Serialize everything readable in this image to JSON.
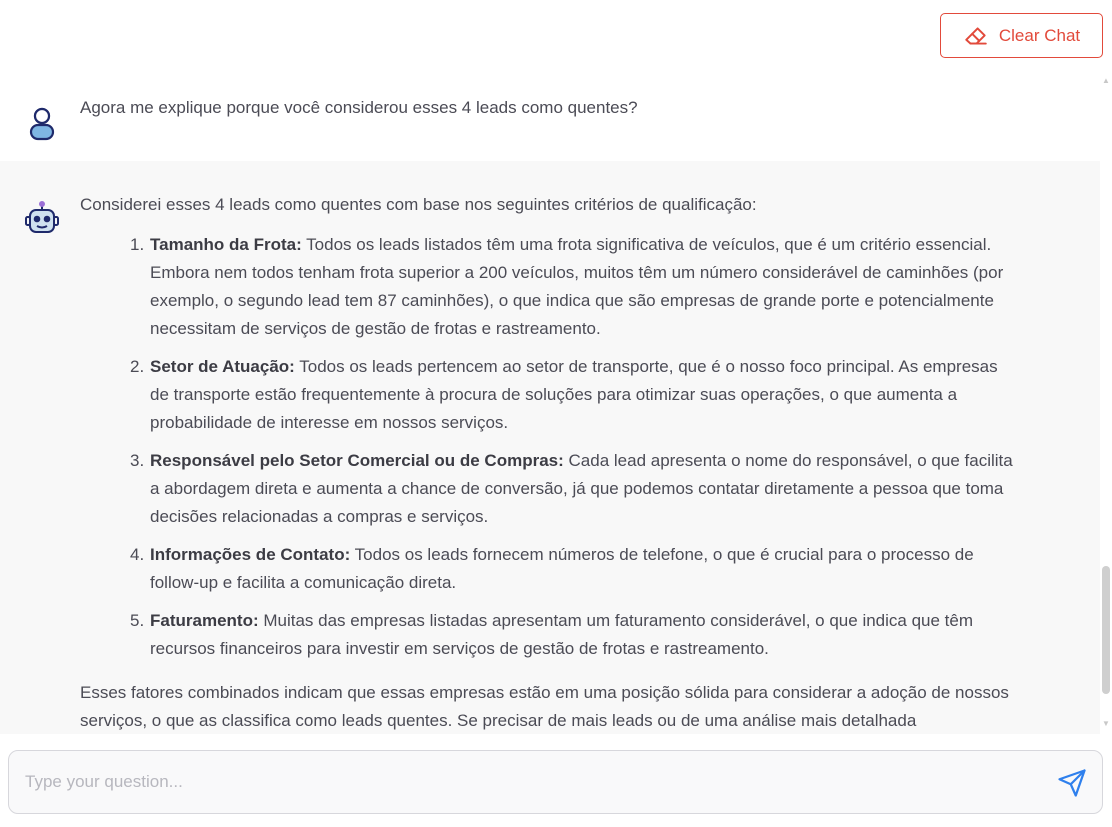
{
  "header": {
    "clear_chat_label": "Clear Chat",
    "clear_chat_icon": "eraser-icon",
    "accent_color": "#e24a3b"
  },
  "messages": {
    "user": {
      "avatar_icon": "user-icon",
      "text": "Agora me explique porque você considerou esses 4 leads como quentes?"
    },
    "bot": {
      "avatar_icon": "robot-icon",
      "intro": "Considerei esses 4 leads como quentes com base nos seguintes critérios de qualificação:",
      "items": [
        {
          "number": "1.",
          "title": "Tamanho da Frota:",
          "text": "Todos os leads listados têm uma frota significativa de veículos, que é um critério essencial. Embora nem todos tenham frota superior a 200 veículos, muitos têm um número considerável de caminhões (por exemplo, o segundo lead tem 87 caminhões), o que indica que são empresas de grande porte e potencialmente necessitam de serviços de gestão de frotas e rastreamento."
        },
        {
          "number": "2.",
          "title": "Setor de Atuação:",
          "text": "Todos os leads pertencem ao setor de transporte, que é o nosso foco principal. As empresas de transporte estão frequentemente à procura de soluções para otimizar suas operações, o que aumenta a probabilidade de interesse em nossos serviços."
        },
        {
          "number": "3.",
          "title": "Responsável pelo Setor Comercial ou de Compras:",
          "text": "Cada lead apresenta o nome do responsável, o que facilita a abordagem direta e aumenta a chance de conversão, já que podemos contatar diretamente a pessoa que toma decisões relacionadas a compras e serviços."
        },
        {
          "number": "4.",
          "title": "Informações de Contato:",
          "text": "Todos os leads fornecem números de telefone, o que é crucial para o processo de follow-up e facilita a comunicação direta."
        },
        {
          "number": "5.",
          "title": "Faturamento:",
          "text": "Muitas das empresas listadas apresentam um faturamento considerável, o que indica que têm recursos financeiros para investir em serviços de gestão de frotas e rastreamento."
        }
      ],
      "outro": "Esses fatores combinados indicam que essas empresas estão em uma posição sólida para considerar a adoção de nossos serviços, o que as classifica como leads quentes. Se precisar de mais leads ou de uma análise mais detalhada"
    }
  },
  "composer": {
    "placeholder": "Type your question...",
    "send_icon": "send-icon",
    "send_color": "#2f80ed"
  }
}
